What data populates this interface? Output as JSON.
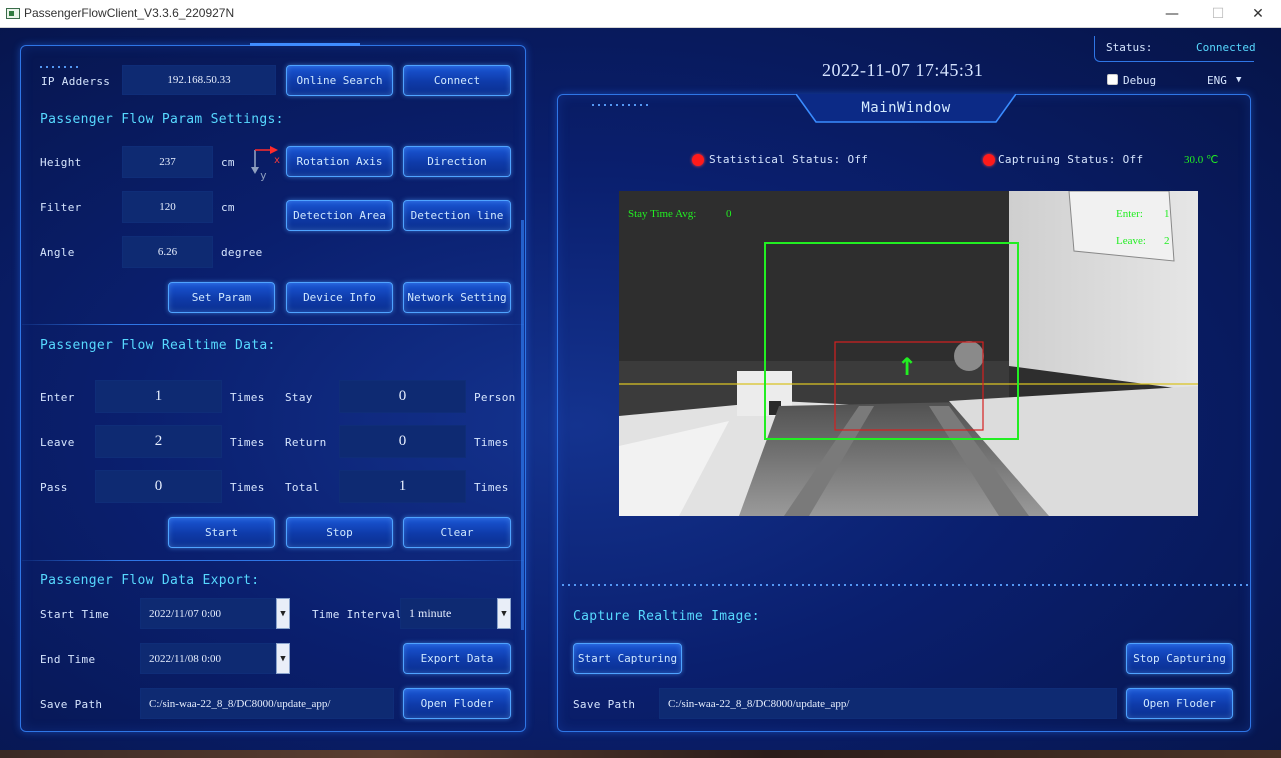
{
  "window": {
    "title": "PassengerFlowClient_V3.3.6_220927N",
    "minimize": "—",
    "maximize": "☐",
    "close": "✕"
  },
  "header": {
    "datetime": "2022-11-07 17:45:31",
    "status_label": "Status:",
    "status_value": "Connected",
    "debug_label": "Debug",
    "language": "ENG",
    "language_arrow": "▼"
  },
  "connection": {
    "ip_label": "IP Adderss",
    "ip_value": "192.168.50.33",
    "online_search": "Online Search",
    "connect": "Connect"
  },
  "params": {
    "title": "Passenger Flow Param Settings:",
    "height_label": "Height",
    "height_value": "237",
    "height_unit": "cm",
    "filter_label": "Filter",
    "filter_value": "120",
    "filter_unit": "cm",
    "angle_label": "Angle",
    "angle_value": "6.26",
    "angle_unit": "degree",
    "axis_x": "x",
    "axis_y": "y",
    "rotation_axis": "Rotation Axis",
    "direction": "Direction",
    "detection_area": "Detection Area",
    "detection_line": "Detection line",
    "set_param": "Set Param",
    "device_info": "Device Info",
    "network_setting": "Network Setting"
  },
  "realtime": {
    "title": "Passenger Flow Realtime Data:",
    "enter_label": "Enter",
    "enter_value": "1",
    "enter_unit": "Times",
    "leave_label": "Leave",
    "leave_value": "2",
    "leave_unit": "Times",
    "pass_label": "Pass",
    "pass_value": "0",
    "pass_unit": "Times",
    "stay_label": "Stay",
    "stay_value": "0",
    "stay_unit": "Person",
    "return_label": "Return",
    "return_value": "0",
    "return_unit": "Times",
    "total_label": "Total",
    "total_value": "1",
    "total_unit": "Times",
    "start": "Start",
    "stop": "Stop",
    "clear": "Clear"
  },
  "export": {
    "title": "Passenger Flow Data Export:",
    "start_time_label": "Start Time",
    "start_time_value": "2022/11/07 0:00",
    "time_interval_label": "Time Interval",
    "time_interval_value": "1 minute",
    "end_time_label": "End Time",
    "end_time_value": "2022/11/08 0:00",
    "export_data": "Export Data",
    "save_path_label": "Save Path",
    "save_path_value": "C:/sin-waa-22_8_8/DC8000/update_app/",
    "open_folder": "Open Floder",
    "dropdown_arrow": "▼"
  },
  "main_window": {
    "tab_title": "MainWindow",
    "statistical_status": "Statistical Status: Off",
    "capturing_status": "Captruing Status: Off",
    "temperature": "30.0 ℃",
    "overlay": {
      "stay_time_label": "Stay Time Avg:",
      "stay_time_value": "0",
      "enter_label": "Enter:",
      "enter_value": "1",
      "leave_label": "Leave:",
      "leave_value": "2",
      "arrow": "↑"
    }
  },
  "capture": {
    "title": "Capture Realtime Image:",
    "start_capturing": "Start Capturing",
    "stop_capturing": "Stop Capturing",
    "save_path_label": "Save Path",
    "save_path_value": "C:/sin-waa-22_8_8/DC8000/update_app/",
    "open_folder": "Open Floder"
  },
  "colors": {
    "accent": "#57d9ff",
    "panel_border": "#2f76e6",
    "status_red": "#ff1a1a",
    "overlay_green": "#22ee22",
    "detection_line": "#d9c323"
  }
}
